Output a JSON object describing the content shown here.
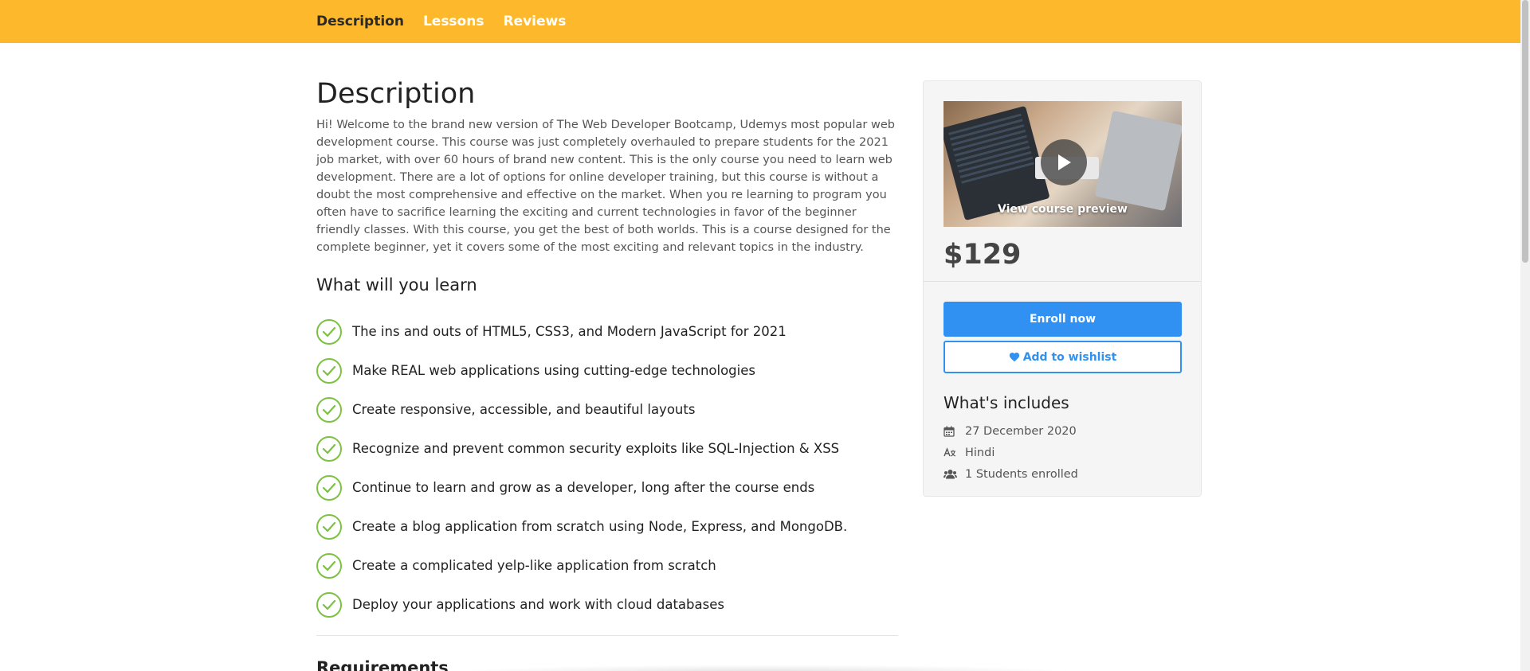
{
  "nav": {
    "tabs": [
      {
        "label": "Description",
        "active": true
      },
      {
        "label": "Lessons",
        "active": false
      },
      {
        "label": "Reviews",
        "active": false
      }
    ]
  },
  "main": {
    "title": "Description",
    "description": "Hi! Welcome to the brand new version of The Web Developer Bootcamp, Udemys most popular web development course. This course was just completely overhauled to prepare students for the 2021 job market, with over 60 hours of brand new content. This is the only course you need to learn web development. There are a lot of options for online developer training, but this course is without a doubt the most comprehensive and effective on the market. When you re learning to program you often have to sacrifice learning the exciting and current technologies in favor of the beginner friendly classes. With this course, you get the best of both worlds. This is a course designed for the complete beginner, yet it covers some of the most exciting and relevant topics in the industry.",
    "learn_title": "What will you learn",
    "learn_items": [
      "The ins and outs of HTML5, CSS3, and Modern JavaScript for 2021",
      "Make REAL web applications using cutting-edge technologies",
      "Create responsive, accessible, and beautiful layouts",
      "Recognize and prevent common security exploits like SQL-Injection & XSS",
      "Continue to learn and grow as a developer, long after the course ends",
      "Create a blog application from scratch using Node, Express, and MongoDB.",
      "Create a complicated yelp-like application from scratch",
      "Deploy your applications and work with cloud databases"
    ],
    "requirements_title": "Requirements"
  },
  "sidebar": {
    "preview_label": "View course preview",
    "price": "$129",
    "enroll_label": "Enroll now",
    "wishlist_label": "Add to wishlist",
    "includes_title": "What's includes",
    "includes": [
      {
        "icon": "calendar-icon",
        "text": "27 December 2020"
      },
      {
        "icon": "language-icon",
        "text": "Hindi"
      },
      {
        "icon": "users-icon",
        "text": "1 Students enrolled"
      }
    ]
  },
  "colors": {
    "topbar": "#fdb92b",
    "accent_blue": "#3191f2",
    "check_green": "#7cc142"
  }
}
